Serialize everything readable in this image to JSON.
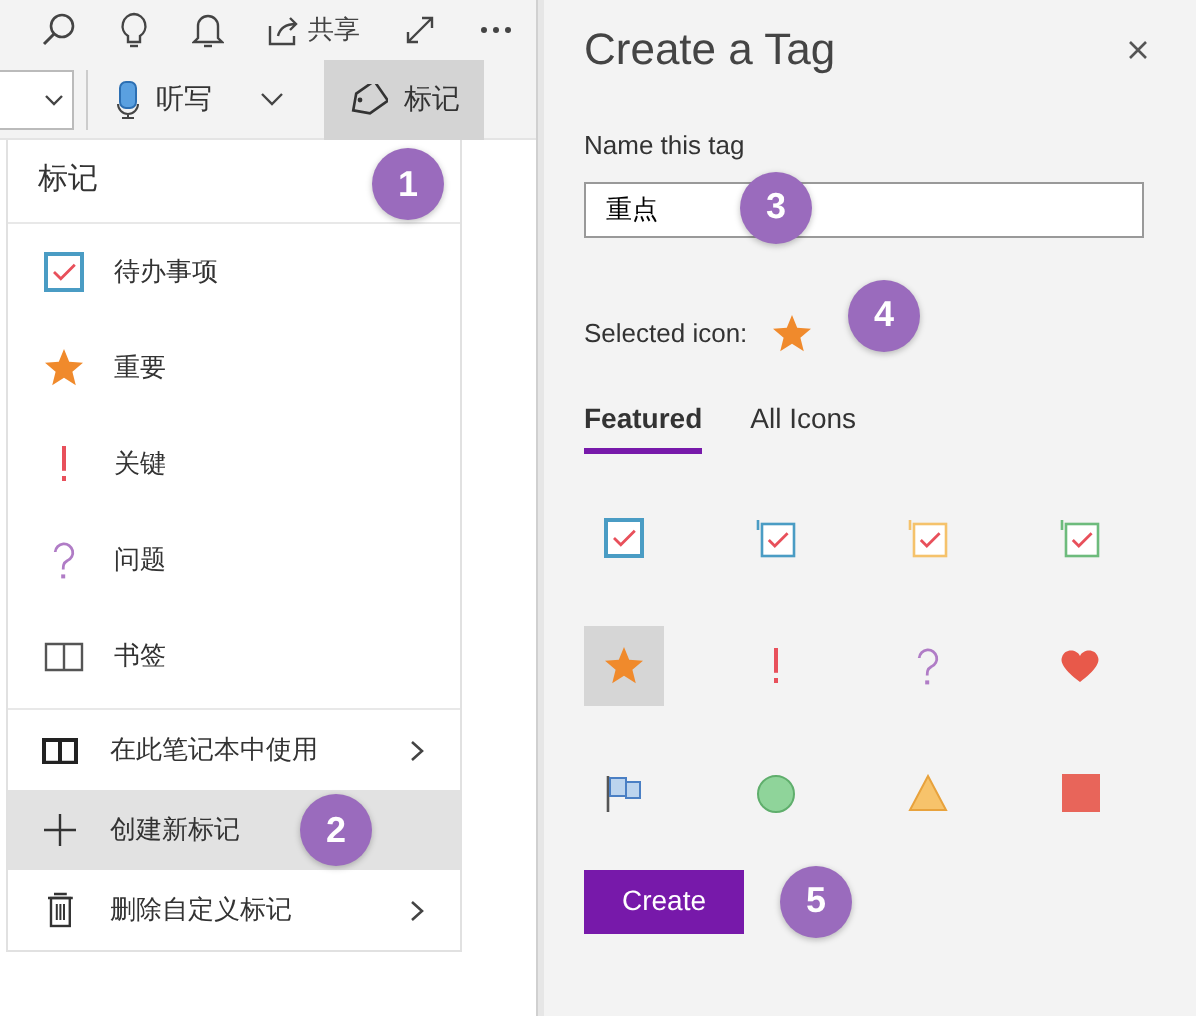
{
  "toolbar": {
    "share_label": "共享"
  },
  "ribbon": {
    "dictate_label": "听写",
    "tag_button": {
      "label": "标记",
      "selected": true
    }
  },
  "tag_menu": {
    "title": "标记",
    "callout": "1",
    "tags": [
      {
        "label": "待办事项",
        "kind": "checkbox"
      },
      {
        "label": "重要",
        "kind": "star"
      },
      {
        "label": "关键",
        "kind": "exclaim"
      },
      {
        "label": "问题",
        "kind": "question"
      },
      {
        "label": "书签",
        "kind": "book"
      }
    ],
    "actions": [
      {
        "label": "在此笔记本中使用",
        "kind": "notebook",
        "submenu": true,
        "highlighted": false
      },
      {
        "label": "创建新标记",
        "kind": "plus",
        "submenu": false,
        "highlighted": true,
        "callout": "2"
      },
      {
        "label": "删除自定义标记",
        "kind": "trash",
        "submenu": true,
        "highlighted": false
      }
    ]
  },
  "dialog": {
    "title": "Create a Tag",
    "name_label": "Name this tag",
    "name_value": "重点",
    "name_callout": "3",
    "selected_icon_label": "Selected icon:",
    "selected_icon": {
      "kind": "star"
    },
    "selected_icon_callout": "4",
    "tabs": [
      {
        "label": "Featured",
        "selected": true
      },
      {
        "label": "All Icons",
        "selected": false
      }
    ],
    "icons": [
      {
        "kind": "checkbox",
        "color": "#4a9cc4",
        "selected": false
      },
      {
        "kind": "numbered-checkbox",
        "color": "#4a9cc4",
        "selected": false
      },
      {
        "kind": "numbered-checkbox",
        "color": "#f5c26b",
        "selected": false
      },
      {
        "kind": "numbered-checkbox",
        "color": "#6dbb7c",
        "selected": false
      },
      {
        "kind": "star",
        "color": "#f08a2c",
        "selected": true
      },
      {
        "kind": "exclaim",
        "color": "#e8505b",
        "selected": false
      },
      {
        "kind": "question",
        "color": "#b07cc6",
        "selected": false
      },
      {
        "kind": "heart",
        "color": "#e8594a",
        "selected": false
      },
      {
        "kind": "flag",
        "color": "#4a7fc4",
        "selected": false
      },
      {
        "kind": "circle",
        "color": "#8fd49a",
        "selected": false
      },
      {
        "kind": "triangle",
        "color": "#f7c36b",
        "selected": false
      },
      {
        "kind": "square",
        "color": "#e8655a",
        "selected": false
      }
    ],
    "create_button": "Create",
    "create_callout": "5"
  }
}
